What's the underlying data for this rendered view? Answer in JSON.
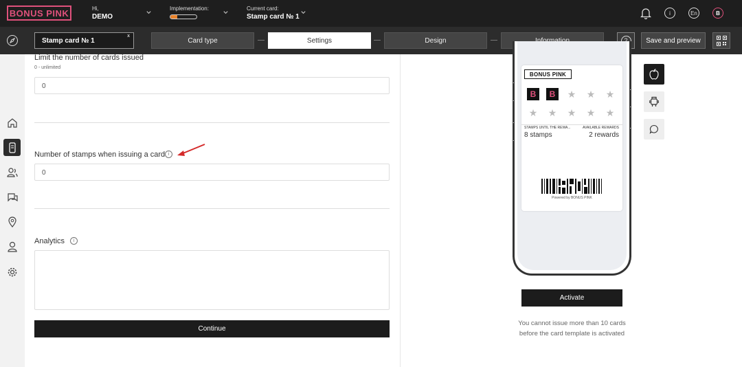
{
  "header": {
    "logo": "BONUS PINK",
    "greeting": "Hi,",
    "user": "DEMO",
    "implementation_label": "Implementation:",
    "implementation_progress": 0.25,
    "current_card_label": "Current card:",
    "current_card": "Stamp card № 1",
    "info_icon": "i",
    "language": "En",
    "avatar_letter": "B"
  },
  "toolbar": {
    "card_select": "Stamp card № 1",
    "card_select_clear": "x",
    "steps": [
      "Card type",
      "Settings",
      "Design",
      "Information"
    ],
    "active_step": "Settings",
    "help": "?",
    "save_label": "Save and preview"
  },
  "sidebar": {
    "items": [
      "home-icon",
      "card-icon",
      "users-icon",
      "chat-icon",
      "location-icon",
      "profile-icon",
      "settings-icon"
    ],
    "active": "card-icon"
  },
  "form": {
    "limit_label": "Limit the number of cards issued",
    "limit_hint": "0 - unlimited",
    "limit_value": "0",
    "stamps_label": "Number of stamps when issuing a card",
    "stamps_value": "0",
    "analytics_label": "Analytics",
    "analytics_value": "",
    "info_icon": "i",
    "continue_label": "Continue"
  },
  "preview": {
    "pass_logo": "BONUS PINK",
    "stamp_letter": "B",
    "star_glyph": "★",
    "stamps_filled": 2,
    "stamps_total": 10,
    "stamps_until_label": "STAMPS UNTIL THE REWA...",
    "stamps_until_value": "8 stamps",
    "rewards_label": "AVAILABLE REWARDS",
    "rewards_value": "2 rewards",
    "powered_by": "Powered by BONUS PINK",
    "platforms": [
      "apple-icon",
      "android-icon",
      "chat-icon"
    ],
    "active_platform": "apple-icon",
    "activate_label": "Activate",
    "note": "You cannot issue more than 10 cards before the card template is activated"
  },
  "colors": {
    "accent": "#e0517c",
    "dark": "#1e1e1e",
    "progress": "#e9832c",
    "arrow": "#d42a2a"
  }
}
